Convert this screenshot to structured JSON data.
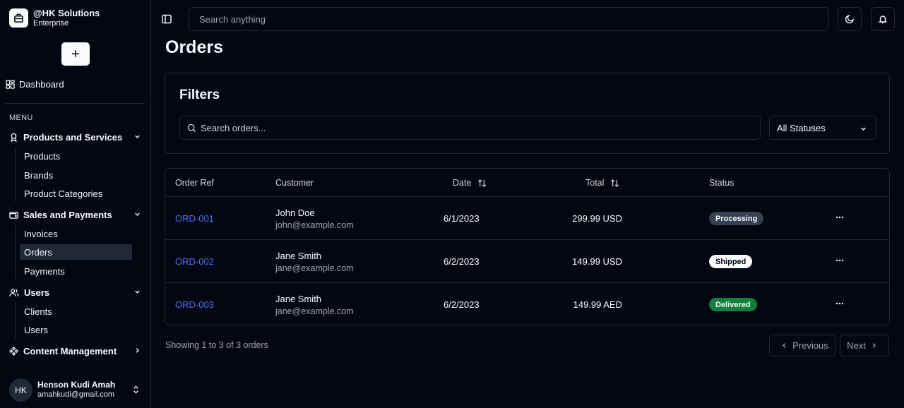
{
  "brand": {
    "name": "@HK Solutions",
    "plan": "Enterprise"
  },
  "sidebar": {
    "add_label": "+",
    "dashboard_label": "Dashboard",
    "menu_label": "MENU",
    "groups": [
      {
        "label": "Products and Services",
        "items": [
          "Products",
          "Brands",
          "Product Categories"
        ]
      },
      {
        "label": "Sales and Payments",
        "items": [
          "Invoices",
          "Orders",
          "Payments"
        ],
        "active_item": "Orders"
      },
      {
        "label": "Users",
        "items": [
          "Clients",
          "Users"
        ]
      },
      {
        "label": "Content Management",
        "items": []
      }
    ]
  },
  "user": {
    "initials": "HK",
    "name": "Henson Kudi Amah",
    "email": "amahkudi@gmail.com"
  },
  "topbar": {
    "search_placeholder": "Search anything"
  },
  "page": {
    "title": "Orders"
  },
  "filters": {
    "title": "Filters",
    "search_placeholder": "Search orders...",
    "status_selected": "All Statuses"
  },
  "table": {
    "headers": {
      "ref": "Order Ref",
      "customer": "Customer",
      "date": "Date",
      "total": "Total",
      "status": "Status"
    },
    "rows": [
      {
        "ref": "ORD-001",
        "name": "John Doe",
        "email": "john@example.com",
        "date": "6/1/2023",
        "total": "299.99 USD",
        "status": "Processing"
      },
      {
        "ref": "ORD-002",
        "name": "Jane Smith",
        "email": "jane@example.com",
        "date": "6/2/2023",
        "total": "149.99 USD",
        "status": "Shipped"
      },
      {
        "ref": "ORD-003",
        "name": "Jane Smith",
        "email": "jane@example.com",
        "date": "6/2/2023",
        "total": "149.99 AED",
        "status": "Delivered"
      }
    ]
  },
  "status_colors": {
    "Processing": {
      "bg": "#374151",
      "fg": "#f9fafb"
    },
    "Shipped": {
      "bg": "#f9fafb",
      "fg": "#030712"
    },
    "Delivered": {
      "bg": "#15803d",
      "fg": "#f0fdf4"
    }
  },
  "pagination": {
    "summary": "Showing 1 to 3 of 3 orders",
    "previous": "Previous",
    "next": "Next"
  },
  "colors": {
    "background": "#030712",
    "border": "#1f2937",
    "link": "#4f6ef7"
  }
}
